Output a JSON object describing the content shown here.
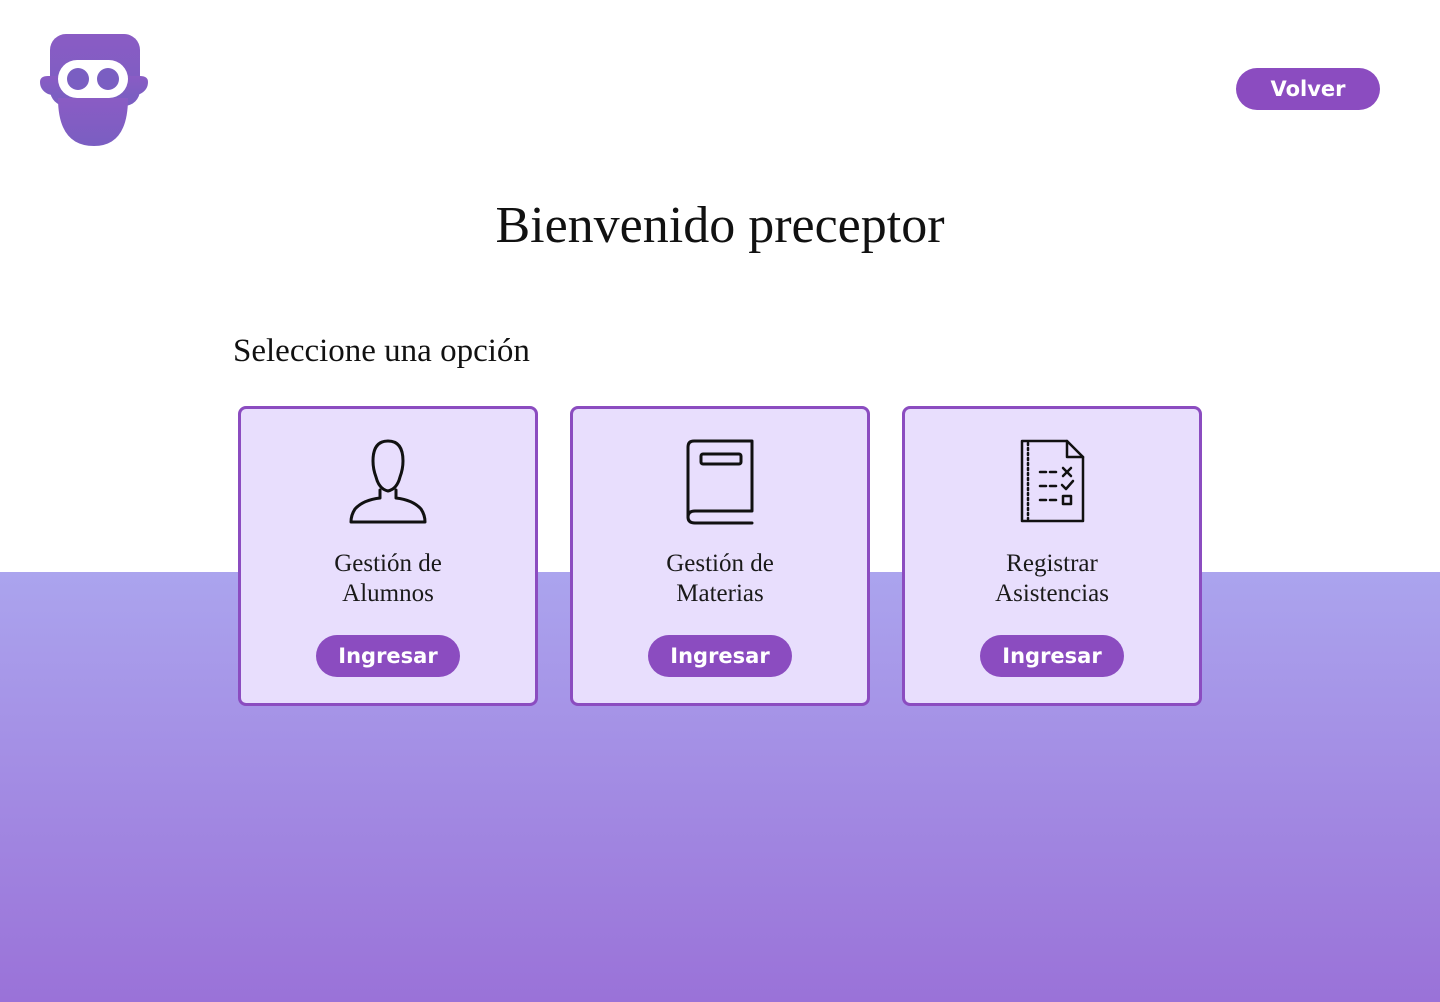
{
  "header": {
    "logo_icon": "owl-mascot-logo",
    "back_button_label": "Volver"
  },
  "main": {
    "title": "Bienvenido preceptor",
    "subtitle": "Seleccione una opción",
    "options": [
      {
        "title": "Gestión de\nAlumnos",
        "icon": "user-icon",
        "button_label": "Ingresar"
      },
      {
        "title": "Gestión de\nMaterias",
        "icon": "book-icon",
        "button_label": "Ingresar"
      },
      {
        "title": "Registrar\nAsistencias",
        "icon": "checklist-icon",
        "button_label": "Ingresar"
      }
    ]
  },
  "colors": {
    "accent": "#8b4cc0",
    "card_background": "#e8defd",
    "band_top": "#aba4ee",
    "band_bottom": "#9a72d8"
  }
}
